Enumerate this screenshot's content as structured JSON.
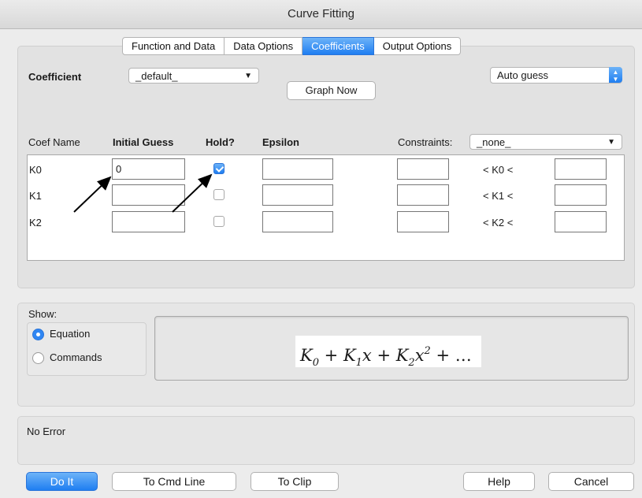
{
  "window": {
    "title": "Curve Fitting"
  },
  "tabs": [
    {
      "label": "Function and Data"
    },
    {
      "label": "Data Options"
    },
    {
      "label": "Coefficients"
    },
    {
      "label": "Output Options"
    }
  ],
  "coefficient": {
    "label": "Coefficient",
    "wave_selected": "_default_",
    "guess_mode": "Auto guess",
    "graph_now_label": "Graph Now"
  },
  "table": {
    "headers": {
      "name": "Coef Name",
      "initial_guess": "Initial Guess",
      "hold": "Hold?",
      "epsilon": "Epsilon",
      "constraints": "Constraints:"
    },
    "constraints_selected": "_none_",
    "rows": [
      {
        "name": "K0",
        "initial_guess": "0",
        "hold": true,
        "epsilon": "",
        "low": "",
        "constraint_text": "< K0 <",
        "high": ""
      },
      {
        "name": "K1",
        "initial_guess": "",
        "hold": false,
        "epsilon": "",
        "low": "",
        "constraint_text": "< K1 <",
        "high": ""
      },
      {
        "name": "K2",
        "initial_guess": "",
        "hold": false,
        "epsilon": "",
        "low": "",
        "constraint_text": "< K2 <",
        "high": ""
      }
    ]
  },
  "show": {
    "label": "Show:",
    "options": [
      {
        "label": "Equation",
        "selected": true
      },
      {
        "label": "Commands",
        "selected": false
      }
    ],
    "equation": {
      "K0": "K",
      "s0": "0",
      "plus1": " + ",
      "K1": "K",
      "s1": "1",
      "x1": "x",
      "plus2": " + ",
      "K2": "K",
      "s2": "2",
      "x2": "x",
      "p2": "2",
      "tail": " + …"
    }
  },
  "status": {
    "text": "No Error"
  },
  "buttons": {
    "do_it": "Do It",
    "to_cmd_line": "To Cmd Line",
    "to_clip": "To Clip",
    "help": "Help",
    "cancel": "Cancel"
  },
  "colors": {
    "accent": "#1f7ef1",
    "window_bg": "#ececec",
    "panel_bg": "#e2e2e2"
  }
}
